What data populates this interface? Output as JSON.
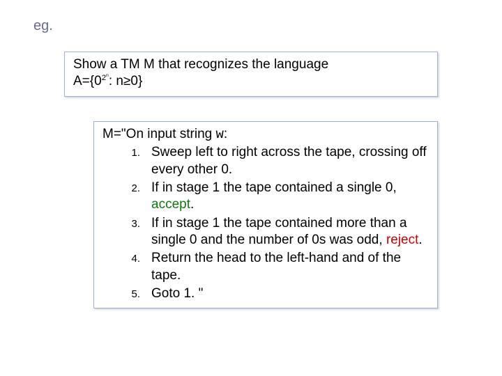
{
  "eg_label": "eg.",
  "problem": {
    "line1": "Show a TM M that recognizes the language",
    "line2_prefix": "A={0",
    "line2_sup": "2",
    "line2_supsup": "n",
    "line2_mid": ": n",
    "line2_geq": "≥",
    "line2_end": "0}"
  },
  "solution": {
    "head_prefix": "M=\"On input string ",
    "head_var": "w",
    "head_suffix": ":",
    "steps": [
      {
        "n": "1.",
        "text": "Sweep left to right across the tape, crossing off every other 0."
      },
      {
        "n": "2.",
        "text_before": "If in stage 1 the tape contained a single 0, ",
        "accept": "accept",
        "text_after": "."
      },
      {
        "n": "3.",
        "text_before": "If in stage 1 the tape contained more than a single 0 and the number of 0s was odd, ",
        "reject": "reject",
        "text_after": "."
      },
      {
        "n": "4.",
        "text": "Return the head to the left-hand and of the tape."
      },
      {
        "n": "5.",
        "text": "Goto 1. \""
      }
    ]
  }
}
